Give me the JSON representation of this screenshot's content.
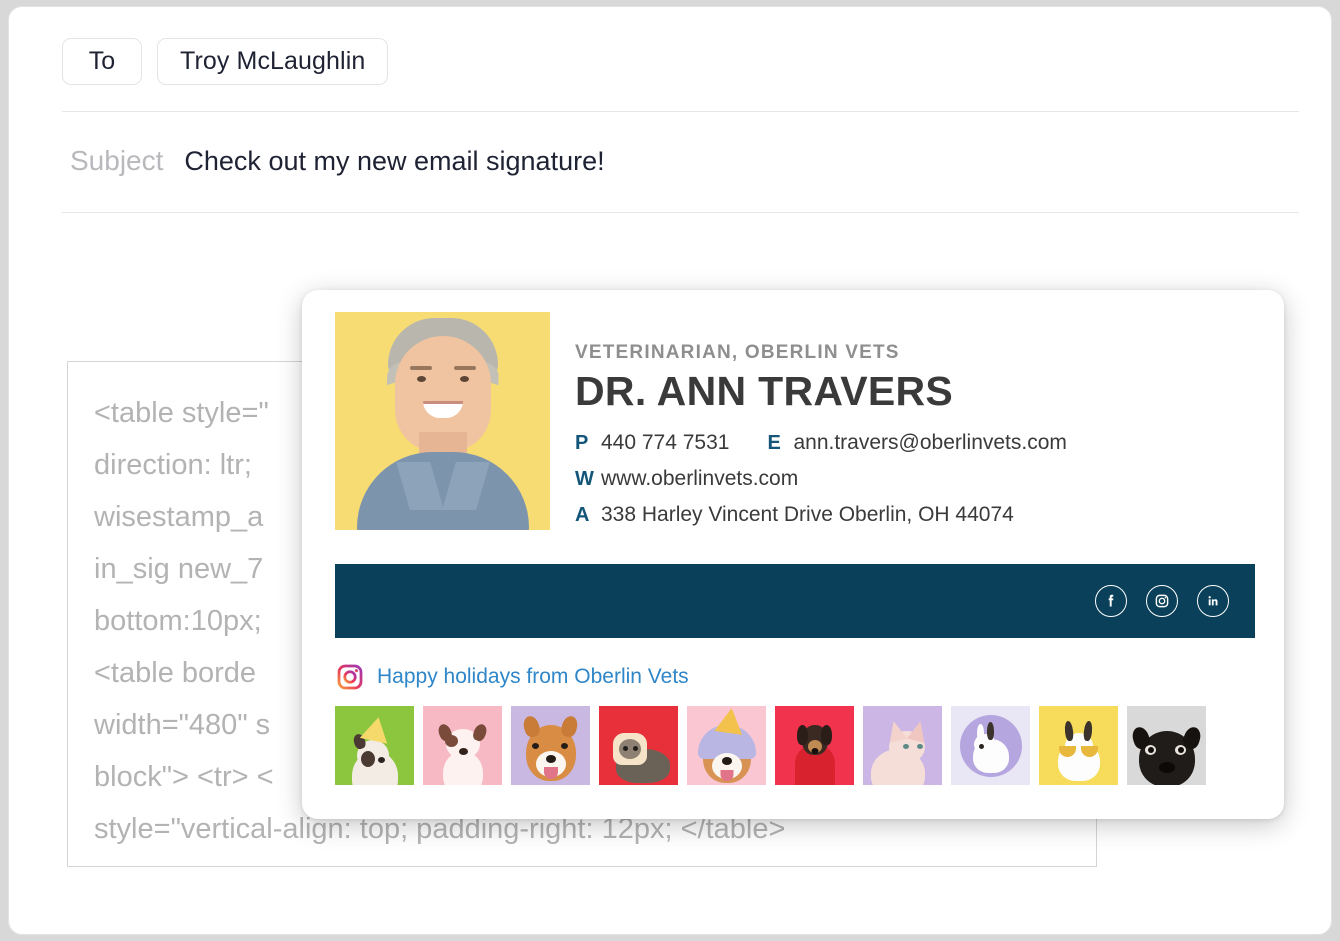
{
  "composer": {
    "to_label": "To",
    "recipient": "Troy McLaughlin",
    "subject_label": "Subject",
    "subject_value": "Check out my new email signature!",
    "body_code": "<table style=\"direction: ltr; wisestamp_ain_sig new_7bottom:10px;<table bordewidth=\"480\" sblock\"> <tr> <style=\"vertical-align: top; padding-right: 12px; </table>",
    "body_code_lines": [
      "<table style=\"",
      "direction: ltr; ",
      "wisestamp_a",
      "in_sig new_7",
      "bottom:10px;",
      "<table borde",
      "width=\"480\" s",
      "block\"> <tr> <",
      "style=\"vertical-align: top; padding-right: 12px; </table>"
    ]
  },
  "signature": {
    "job_title": "VETERINARIAN, OBERLIN VETS",
    "name": "DR. ANN TRAVERS",
    "contacts": [
      {
        "key": "P",
        "value": "440 774 7531"
      },
      {
        "key": "E",
        "value": "ann.travers@oberlinvets.com"
      },
      {
        "key": "W",
        "value": "www.oberlinvets.com"
      },
      {
        "key": "A",
        "value": "338 Harley Vincent Drive Oberlin, OH 44074"
      }
    ],
    "social": [
      {
        "name": "facebook-icon",
        "label": "Facebook"
      },
      {
        "name": "instagram-icon",
        "label": "Instagram"
      },
      {
        "name": "linkedin-icon",
        "label": "LinkedIn"
      }
    ],
    "instagram_feed": {
      "icon": "instagram-icon",
      "caption": "Happy holidays from Oberlin Vets",
      "thumbnails": [
        {
          "alt": "dog in party hat",
          "bg": "#8cc63f"
        },
        {
          "alt": "french bulldog puppy",
          "bg": "#f7b9c4"
        },
        {
          "alt": "shiba inu smiling",
          "bg": "#c8b8e2"
        },
        {
          "alt": "cat in bread costume",
          "bg": "#e8303a"
        },
        {
          "alt": "dog in unicorn hood",
          "bg": "#f9c6d2"
        },
        {
          "alt": "dachshund in red coat",
          "bg": "#f2334d"
        },
        {
          "alt": "sphynx cat",
          "bg": "#cbb6e6"
        },
        {
          "alt": "white rabbit",
          "bg": "#e9e6f5"
        },
        {
          "alt": "rabbit with sunglasses",
          "bg": "#f6dc5a"
        },
        {
          "alt": "black pug",
          "bg": "#d9d9d9"
        }
      ]
    },
    "colors": {
      "bar": "#0a4059",
      "accent": "#14567a",
      "link": "#2f86c8",
      "portrait_bg": "#f7dc74"
    }
  }
}
